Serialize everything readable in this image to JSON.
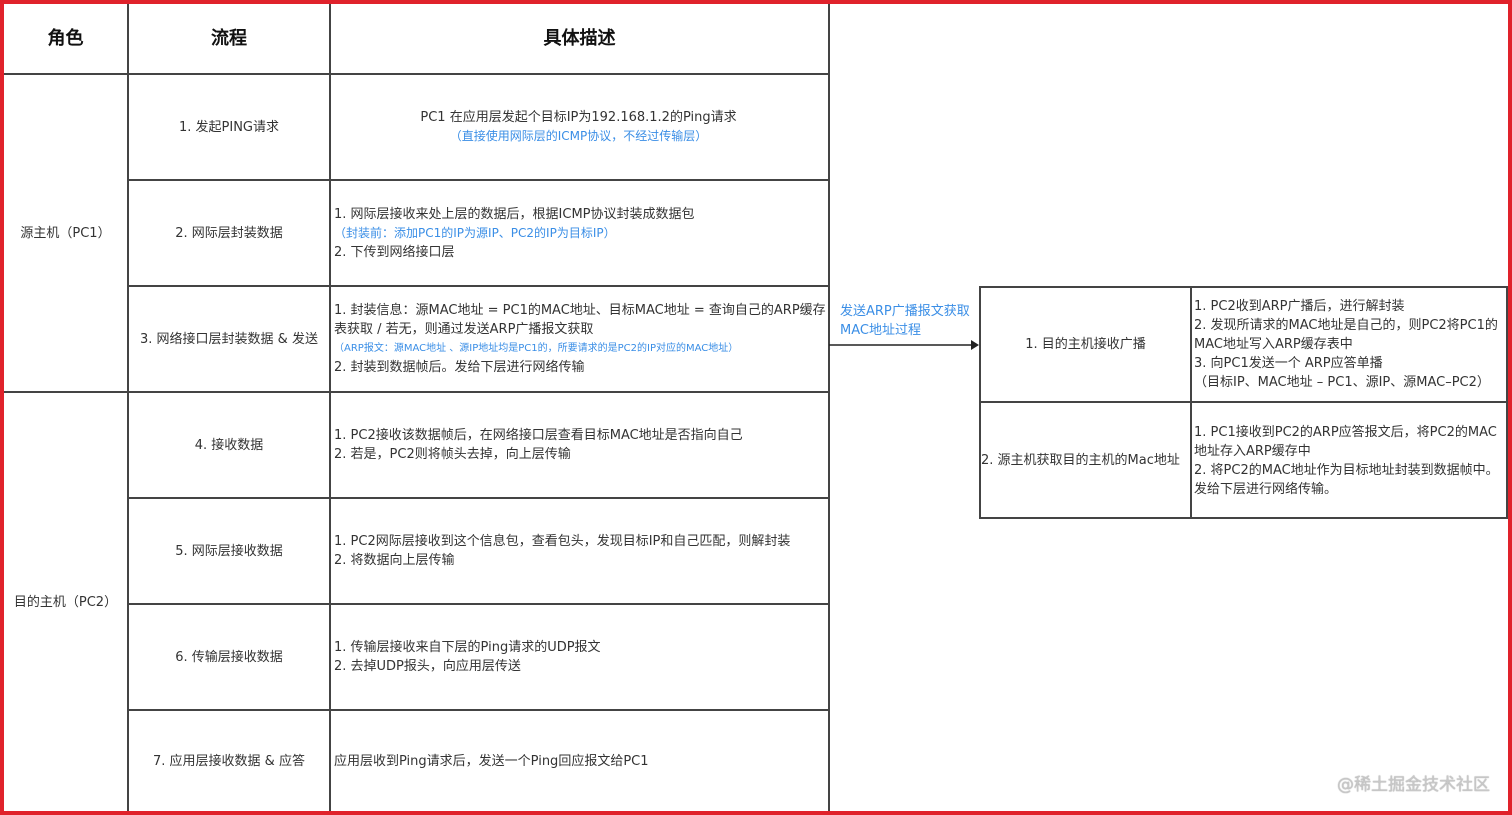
{
  "header": {
    "role": "角色",
    "process": "流程",
    "description": "具体描述"
  },
  "roles": {
    "source": "源主机（PC1）",
    "target": "目的主机（PC2）"
  },
  "steps": [
    {
      "name": "1. 发起PING请求",
      "lines": [
        {
          "text": "PC1 在应用层发起个目标IP为192.168.1.2的Ping请求",
          "style": "normal"
        },
        {
          "text": "（直接使用网际层的ICMP协议，不经过传输层）",
          "style": "blue"
        }
      ]
    },
    {
      "name": "2. 网际层封装数据",
      "lines": [
        {
          "text": "1. 网际层接收来处上层的数据后，根据ICMP协议封装成数据包",
          "style": "normal"
        },
        {
          "text": "（封装前：添加PC1的IP为源IP、PC2的IP为目标IP）",
          "style": "blue"
        },
        {
          "text": "2. 下传到网络接口层",
          "style": "normal"
        }
      ]
    },
    {
      "name": "3. 网络接口层封装数据 & 发送",
      "lines": [
        {
          "text": "1. 封装信息：源MAC地址 = PC1的MAC地址、目标MAC地址 = 查询自己的ARP缓存表获取 / 若无，则通过发送ARP广播报文获取",
          "style": "normal"
        },
        {
          "text": "（ARP报文：源MAC地址 、源IP地址均是PC1的，所要请求的是PC2的IP对应的MAC地址）",
          "style": "blue-sm"
        },
        {
          "text": "2. 封装到数据帧后。发给下层进行网络传输",
          "style": "normal"
        }
      ]
    },
    {
      "name": "4. 接收数据",
      "lines": [
        {
          "text": "1. PC2接收该数据帧后，在网络接口层查看目标MAC地址是否指向自己",
          "style": "normal"
        },
        {
          "text": "2. 若是，PC2则将帧头去掉，向上层传输",
          "style": "normal"
        }
      ]
    },
    {
      "name": "5. 网际层接收数据",
      "lines": [
        {
          "text": "1. PC2网际层接收到这个信息包，查看包头，发现目标IP和自己匹配，则解封装",
          "style": "normal"
        },
        {
          "text": "2. 将数据向上层传输",
          "style": "normal"
        }
      ]
    },
    {
      "name": "6. 传输层接收数据",
      "lines": [
        {
          "text": "1. 传输层接收来自下层的Ping请求的UDP报文",
          "style": "normal"
        },
        {
          "text": "2. 去掉UDP报头，向应用层传送",
          "style": "normal"
        }
      ]
    },
    {
      "name": "7. 应用层接收数据 & 应答",
      "lines": [
        {
          "text": "应用层收到Ping请求后，发送一个Ping回应报文给PC1",
          "style": "normal"
        }
      ]
    }
  ],
  "arp": {
    "arrow_label": "发送ARP广播报文获取MAC地址过程",
    "rows": [
      {
        "name": "1. 目的主机接收广播",
        "lines": [
          "1.  PC2收到ARP广播后，进行解封装",
          "2. 发现所请求的MAC地址是自己的，则PC2将PC1的MAC地址写入ARP缓存表中",
          "3. 向PC1发送一个 ARP应答单播",
          "（目标IP、MAC地址 – PC1、源IP、源MAC–PC2）"
        ]
      },
      {
        "name": "2. 源主机获取目的主机的Mac地址",
        "lines": [
          "1. PC1接收到PC2的ARP应答报文后，将PC2的MAC地址存入ARP缓存中",
          "2. 将PC2的MAC地址作为目标地址封装到数据帧中。发给下层进行网络传输。"
        ]
      }
    ]
  },
  "watermark": "@稀土掘金技术社区",
  "colors": {
    "border": "#e0222b",
    "accent": "#3a8ee6",
    "grid": "#444444"
  }
}
